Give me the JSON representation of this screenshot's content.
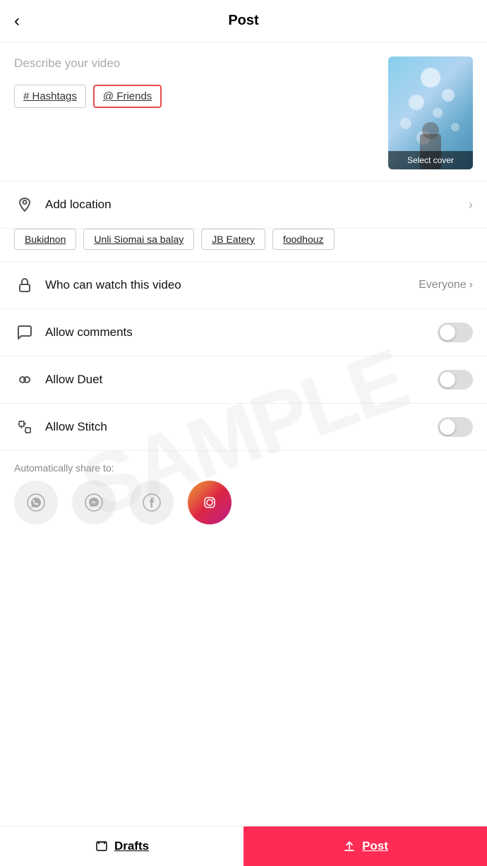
{
  "header": {
    "back_label": "‹",
    "title": "Post"
  },
  "describe": {
    "placeholder": "Describe your video",
    "hashtag_label": "# Hashtags",
    "friends_label": "@ Friends"
  },
  "video_thumb": {
    "select_cover_label": "Select cover"
  },
  "location": {
    "label": "Add location",
    "chips": [
      "Bukidnon",
      "Unli Siomai sa balay",
      "JB Eatery",
      "foodhouz"
    ]
  },
  "who_can_watch": {
    "label": "Who can watch this video",
    "value": "Everyone"
  },
  "allow_comments": {
    "label": "Allow comments",
    "enabled": false
  },
  "allow_duet": {
    "label": "Allow Duet",
    "enabled": false
  },
  "allow_stitch": {
    "label": "Allow Stitch",
    "enabled": false
  },
  "share": {
    "label": "Automatically share to:",
    "platforms": [
      "whatsapp",
      "messenger",
      "facebook",
      "instagram"
    ]
  },
  "footer": {
    "drafts_label": "Drafts",
    "post_label": "Post"
  },
  "watermark": "SAMPLE"
}
